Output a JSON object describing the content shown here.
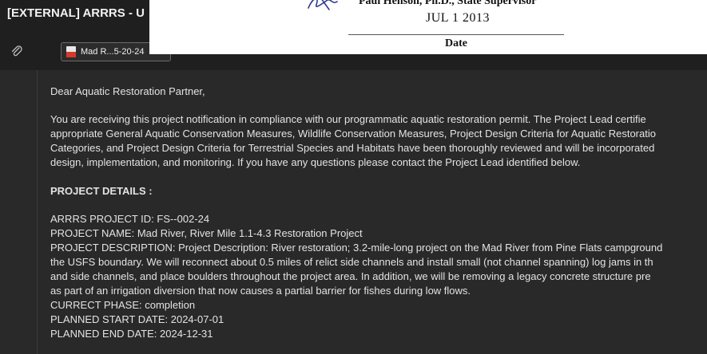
{
  "window": {
    "title": "[EXTERNAL] ARRRS - U"
  },
  "attachment": {
    "name": "Mad R...5-20-24"
  },
  "signature_overlay": {
    "signer": "Paul Henson, Ph.D., State Supervisor",
    "date_handwritten": "JUL   1 2013",
    "date_label": "Date"
  },
  "email": {
    "greeting": "Dear Aquatic Restoration Partner,",
    "intro_lines": [
      "You are receiving this project notification in compliance with our programmatic aquatic restoration permit. The Project Lead certifie",
      "appropriate General Aquatic Conservation Measures, Wildlife Conservation Measures, Project Design Criteria for Aquatic Restoratio",
      "Categories, and Project Design Criteria for Terrestrial Species and Habitats have been thoroughly reviewed and will be incorporated",
      "design, implementation, and monitoring. If you have any questions please contact the Project Lead identified below."
    ],
    "details_heading": "PROJECT DETAILS :",
    "details_lines": [
      "ARRRS PROJECT ID: FS--002-24",
      "PROJECT NAME: Mad River, River Mile 1.1-4.3 Restoration Project",
      "PROJECT DESCRIPTION: Project Description: River restoration; 3.2-mile-long project on the Mad River from Pine Flats campground",
      "the USFS boundary. We will reconnect about 0.5 miles of relict side channels and install small (not channel spanning) log jams in th",
      "and side channels, and place boulders throughout the project area. In addition, we will be removing a legacy concrete structure pre",
      "as part of an irrigation diversion that now causes a partial barrier for fishes during low flows.",
      "CURRECT PHASE: completion",
      "PLANNED START DATE: 2024-07-01",
      "PLANNED END DATE: 2024-12-31"
    ]
  }
}
